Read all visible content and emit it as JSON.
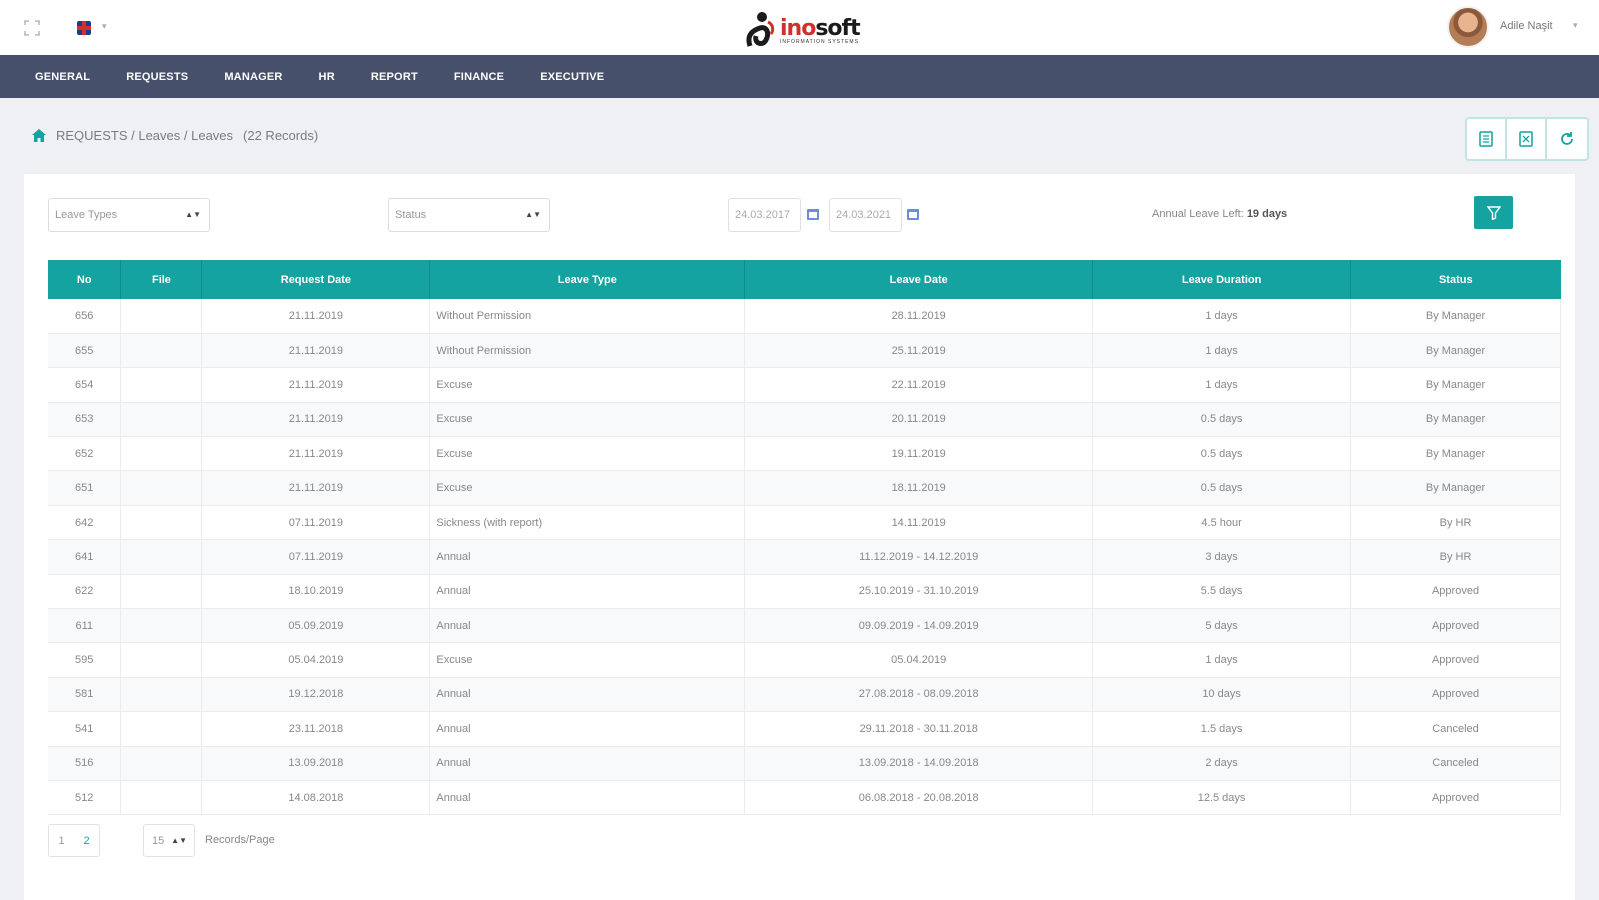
{
  "header": {
    "logo_ino": "ino",
    "logo_soft": "soft",
    "logo_tagline": "INFORMATION SYSTEMS",
    "user_name": "Adile Naşit"
  },
  "nav": [
    "GENERAL",
    "REQUESTS",
    "MANAGER",
    "HR",
    "REPORT",
    "FINANCE",
    "EXECUTIVE"
  ],
  "breadcrumb": {
    "path": "REQUESTS / Leaves / Leaves",
    "count": "(22 Records)"
  },
  "filters": {
    "leave_types": "Leave Types",
    "status": "Status",
    "date_from": "24.03.2017",
    "date_to": "24.03.2021",
    "annual_label": "Annual Leave Left:",
    "annual_value": "19 days"
  },
  "table": {
    "headers": [
      "No",
      "File",
      "Request Date",
      "Leave Type",
      "Leave Date",
      "Leave Duration",
      "Status"
    ],
    "rows": [
      [
        "656",
        "",
        "21.11.2019",
        "Without Permission",
        "28.11.2019",
        "1 days",
        "By Manager"
      ],
      [
        "655",
        "",
        "21.11.2019",
        "Without Permission",
        "25.11.2019",
        "1 days",
        "By Manager"
      ],
      [
        "654",
        "",
        "21.11.2019",
        "Excuse",
        "22.11.2019",
        "1 days",
        "By Manager"
      ],
      [
        "653",
        "",
        "21.11.2019",
        "Excuse",
        "20.11.2019",
        "0.5 days",
        "By Manager"
      ],
      [
        "652",
        "",
        "21.11.2019",
        "Excuse",
        "19.11.2019",
        "0.5 days",
        "By Manager"
      ],
      [
        "651",
        "",
        "21.11.2019",
        "Excuse",
        "18.11.2019",
        "0.5 days",
        "By Manager"
      ],
      [
        "642",
        "",
        "07.11.2019",
        "Sickness (with report)",
        "14.11.2019",
        "4.5 hour",
        "By HR"
      ],
      [
        "641",
        "",
        "07.11.2019",
        "Annual",
        "11.12.2019 - 14.12.2019",
        "3 days",
        "By HR"
      ],
      [
        "622",
        "",
        "18.10.2019",
        "Annual",
        "25.10.2019 - 31.10.2019",
        "5.5 days",
        "Approved"
      ],
      [
        "611",
        "",
        "05.09.2019",
        "Annual",
        "09.09.2019 - 14.09.2019",
        "5 days",
        "Approved"
      ],
      [
        "595",
        "",
        "05.04.2019",
        "Excuse",
        "05.04.2019",
        "1 days",
        "Approved"
      ],
      [
        "581",
        "",
        "19.12.2018",
        "Annual",
        "27.08.2018 - 08.09.2018",
        "10 days",
        "Approved"
      ],
      [
        "541",
        "",
        "23.11.2018",
        "Annual",
        "29.11.2018 - 30.11.2018",
        "1.5 days",
        "Canceled"
      ],
      [
        "516",
        "",
        "13.09.2018",
        "Annual",
        "13.09.2018 - 14.09.2018",
        "2 days",
        "Canceled"
      ],
      [
        "512",
        "",
        "14.08.2018",
        "Annual",
        "06.08.2018 - 20.08.2018",
        "12.5 days",
        "Approved"
      ]
    ]
  },
  "pagination": {
    "pages": [
      "1",
      "2"
    ],
    "active_page": "2",
    "per_page": "15",
    "per_page_label": "Records/Page"
  },
  "colors": {
    "accent": "#14a3a0",
    "navbar": "#46506b"
  },
  "icons": {
    "toolbar": [
      "excel-icon",
      "export-icon",
      "refresh-icon"
    ]
  }
}
